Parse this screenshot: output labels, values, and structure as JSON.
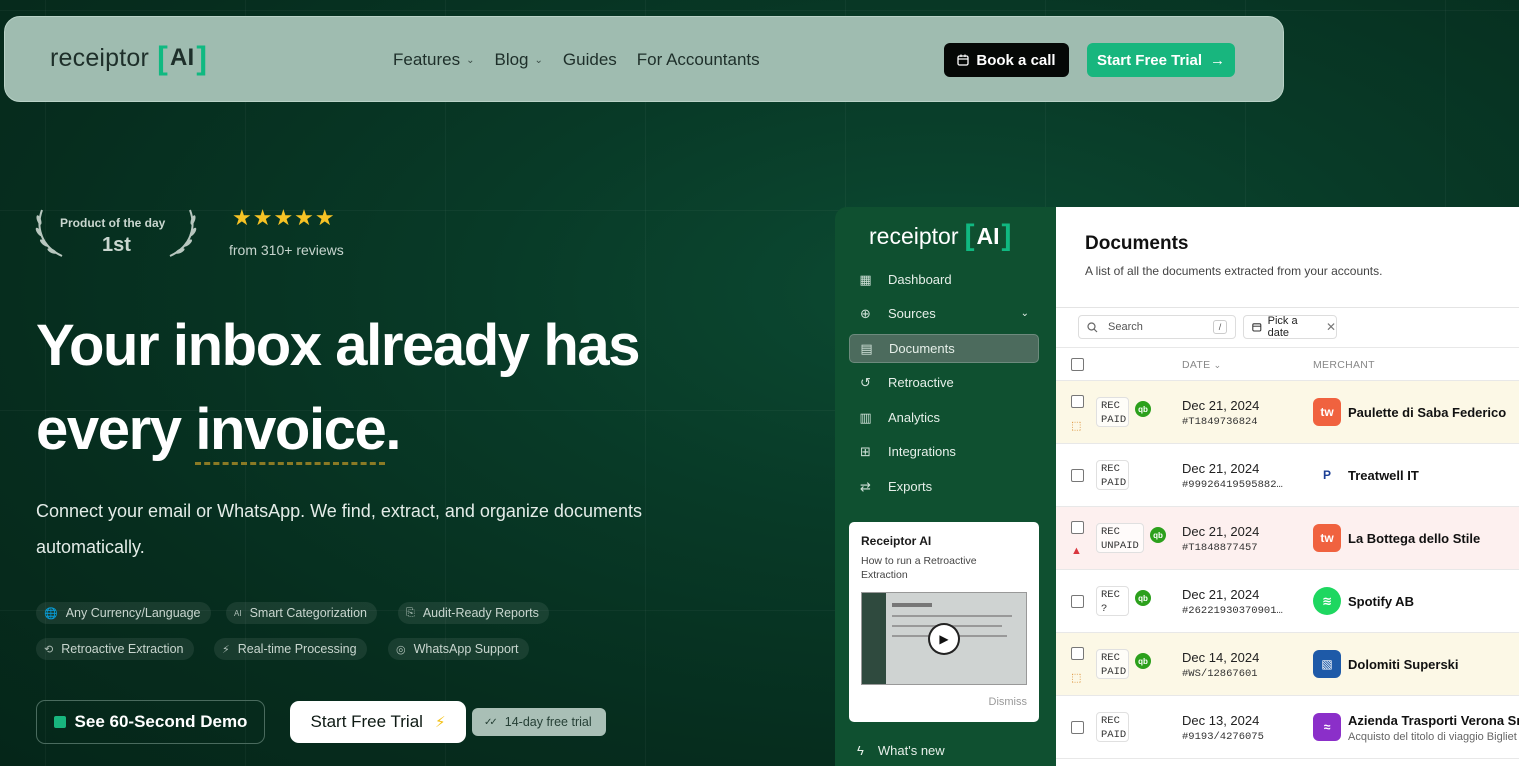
{
  "nav": {
    "logo_text": "receiptor",
    "logo_bracket_left": "[",
    "logo_ai": "AI",
    "logo_bracket_right": "]",
    "links": [
      {
        "label": "Features",
        "dropdown": true
      },
      {
        "label": "Blog",
        "dropdown": true
      },
      {
        "label": "Guides",
        "dropdown": false
      },
      {
        "label": "For Accountants",
        "dropdown": false
      }
    ],
    "book_label": "Book a call",
    "trial_label": "Start Free Trial",
    "trial_arrow": "→"
  },
  "hero": {
    "badge_line1": "Product of the day",
    "badge_line2": "1st",
    "stars": "★★★★★",
    "reviews": "from 310+ reviews",
    "title_line1": "Your inbox already has",
    "title_line2_prefix": "every ",
    "title_line2_underlined": "invoice",
    "title_line2_suffix": ".",
    "subtitle": "Connect your email or WhatsApp. We find, extract, and organize documents automatically.",
    "chips": [
      {
        "icon": "🌐",
        "label": "Any Currency/Language"
      },
      {
        "icon": "AI",
        "label": "Smart Categorization"
      },
      {
        "icon": "⎘",
        "label": "Audit-Ready Reports"
      },
      {
        "icon": "⟲",
        "label": "Retroactive Extraction"
      },
      {
        "icon": "⚡",
        "label": "Real-time Processing"
      },
      {
        "icon": "◎",
        "label": "WhatsApp Support"
      }
    ],
    "demo_label": "See 60-Second Demo",
    "start_label": "Start Free Trial",
    "trial_pill": "14-day free trial",
    "trial_pill_icon": "✓✓"
  },
  "app": {
    "logo_text": "receiptor",
    "logo_ai": "AI",
    "sidebar": [
      {
        "icon": "▦",
        "label": "Dashboard"
      },
      {
        "icon": "⊕",
        "label": "Sources",
        "expand": "⌄"
      },
      {
        "icon": "▤",
        "label": "Documents",
        "active": true
      },
      {
        "icon": "↺",
        "label": "Retroactive"
      },
      {
        "icon": "▥",
        "label": "Analytics"
      },
      {
        "icon": "⊞",
        "label": "Integrations"
      },
      {
        "icon": "⇄",
        "label": "Exports"
      }
    ],
    "card_title": "Receiptor AI",
    "card_subtitle": "How to run a Retroactive Extraction",
    "card_dismiss": "Dismiss",
    "whats_new": "What's new",
    "page_title": "Documents",
    "page_subtitle": "A list of all the documents extracted from your accounts.",
    "search_placeholder": "Search",
    "search_key": "/",
    "pick_date": "Pick a date",
    "col_date": "DATE",
    "col_merchant": "MERCHANT",
    "rows": [
      {
        "tag1": "REC",
        "tag2": "PAID",
        "qb": true,
        "flag": "tag",
        "date": "Dec 21, 2024",
        "id": "#T1849736824",
        "merchant": "Paulette di Saba Federico",
        "logo": "tw",
        "logo_color": "#f0623f",
        "bg": "#fcf8e6"
      },
      {
        "tag1": "REC",
        "tag2": "PAID",
        "qb": false,
        "flag": "",
        "date": "Dec 21, 2024",
        "id": "#99926419595882…",
        "merchant": "Treatwell IT",
        "logo": "P",
        "logo_color": "#ffffff",
        "bg": "#ffffff"
      },
      {
        "tag1": "REC",
        "tag2": "UNPAID",
        "qb": true,
        "flag": "warn",
        "date": "Dec 21, 2024",
        "id": "#T1848877457",
        "merchant": "La Bottega dello Stile",
        "logo": "tw",
        "logo_color": "#f0623f",
        "bg": "#fdf0ef"
      },
      {
        "tag1": "REC",
        "tag2": "?",
        "qb": true,
        "flag": "",
        "date": "Dec 21, 2024",
        "id": "#26221930370901…",
        "merchant": "Spotify AB",
        "logo": "≋",
        "logo_color": "#1ed760",
        "bg": "#ffffff"
      },
      {
        "tag1": "REC",
        "tag2": "PAID",
        "qb": true,
        "flag": "tag",
        "date": "Dec 14, 2024",
        "id": "#WS/12867601",
        "merchant": "Dolomiti Superski",
        "logo": "▧",
        "logo_color": "#1e5aa8",
        "bg": "#fcf8e6"
      },
      {
        "tag1": "REC",
        "tag2": "PAID",
        "qb": false,
        "flag": "",
        "date": "Dec 13, 2024",
        "id": "#9193/4276075",
        "merchant": "Azienda Trasporti Verona Srl",
        "merchant_sub": "Acquisto del titolo di viaggio Bigliet",
        "logo": "≈",
        "logo_color": "#8b2fc9",
        "bg": "#ffffff"
      }
    ]
  }
}
